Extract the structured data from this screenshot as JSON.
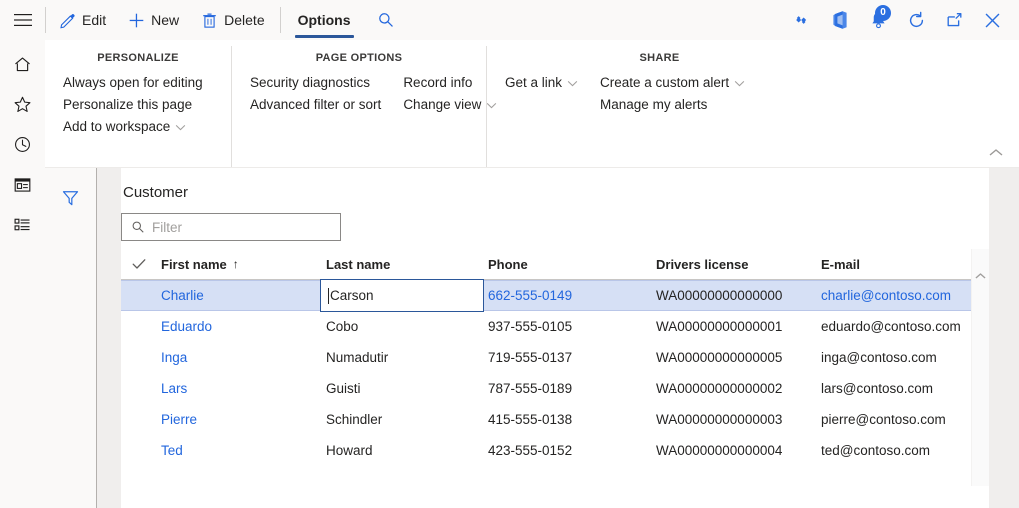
{
  "commandbar": {
    "menu_icon": "hamburger-icon",
    "buttons": [
      {
        "label": "Edit",
        "icon": "pencil-icon"
      },
      {
        "label": "New",
        "icon": "plus-icon"
      },
      {
        "label": "Delete",
        "icon": "trash-icon"
      }
    ],
    "active_tab": "Options",
    "search_icon": "search-icon",
    "right_icons": [
      {
        "name": "dynamics-diamond-icon",
        "badge": null
      },
      {
        "name": "office-app-launcher-icon",
        "badge": null
      },
      {
        "name": "notifications-bell-icon",
        "badge": "0"
      },
      {
        "name": "refresh-icon",
        "badge": null
      },
      {
        "name": "popout-window-icon",
        "badge": null
      },
      {
        "name": "close-icon",
        "badge": null
      }
    ]
  },
  "navrail": {
    "items": [
      {
        "name": "home-icon",
        "label": "Home"
      },
      {
        "name": "favorites-star-icon",
        "label": "Favorites"
      },
      {
        "name": "recent-clock-icon",
        "label": "Recent"
      },
      {
        "name": "workspaces-icon",
        "label": "Workspaces"
      },
      {
        "name": "modules-list-icon",
        "label": "Modules"
      }
    ]
  },
  "ribbon": {
    "collapse_icon": "chevron-up-icon",
    "groups": [
      {
        "title": "PERSONALIZE",
        "columns": [
          {
            "links": [
              {
                "label": "Always open for editing",
                "caret": false
              },
              {
                "label": "Personalize this page",
                "caret": false
              },
              {
                "label": "Add to workspace",
                "caret": true
              }
            ]
          }
        ]
      },
      {
        "title": "PAGE OPTIONS",
        "columns": [
          {
            "links": [
              {
                "label": "Security diagnostics",
                "caret": false
              },
              {
                "label": "Advanced filter or sort",
                "caret": false
              }
            ]
          },
          {
            "links": [
              {
                "label": "Record info",
                "caret": false
              },
              {
                "label": "Change view",
                "caret": true
              }
            ]
          }
        ]
      },
      {
        "title": "SHARE",
        "columns": [
          {
            "links": [
              {
                "label": "Get a link",
                "caret": true
              }
            ]
          },
          {
            "links": [
              {
                "label": "Create a custom alert",
                "caret": true
              },
              {
                "label": "Manage my alerts",
                "caret": false
              }
            ]
          }
        ]
      }
    ]
  },
  "page": {
    "filter_rail_icon": "filter-funnel-icon",
    "grid_title": "Customer",
    "filter": {
      "icon": "search-icon",
      "value": "",
      "placeholder": "Filter"
    },
    "table": {
      "select_all_icon": "checkmark-icon",
      "sort_indicator": "↑",
      "sorted_column": "First name",
      "columns": [
        "First name",
        "Last name",
        "Phone",
        "Drivers license",
        "E-mail"
      ],
      "editing": {
        "row": 0,
        "column": "Last name",
        "value": "Carson"
      },
      "rows": [
        {
          "first": "Charlie",
          "last": "Carson",
          "phone": "662-555-0149",
          "dl": "WA00000000000000",
          "email": "charlie@contoso.com",
          "selected": true
        },
        {
          "first": "Eduardo",
          "last": "Cobo",
          "phone": "937-555-0105",
          "dl": "WA00000000000001",
          "email": "eduardo@contoso.com",
          "selected": false
        },
        {
          "first": "Inga",
          "last": "Numadutir",
          "phone": "719-555-0137",
          "dl": "WA00000000000005",
          "email": "inga@contoso.com",
          "selected": false
        },
        {
          "first": "Lars",
          "last": "Guisti",
          "phone": "787-555-0189",
          "dl": "WA00000000000002",
          "email": "lars@contoso.com",
          "selected": false
        },
        {
          "first": "Pierre",
          "last": "Schindler",
          "phone": "415-555-0138",
          "dl": "WA00000000000003",
          "email": "pierre@contoso.com",
          "selected": false
        },
        {
          "first": "Ted",
          "last": "Howard",
          "phone": "423-555-0152",
          "dl": "WA00000000000004",
          "email": "ted@contoso.com",
          "selected": false
        }
      ]
    },
    "scrollbar": {
      "up_icon": "chevron-up-icon"
    }
  },
  "colors": {
    "accent_blue": "#2266dd",
    "tab_underline": "#2b579a",
    "selected_row": "#d6e0f5",
    "icon_blue": "#2b6fe0",
    "page_bg": "#f0eeed",
    "chrome_bg": "#faf9f8"
  }
}
